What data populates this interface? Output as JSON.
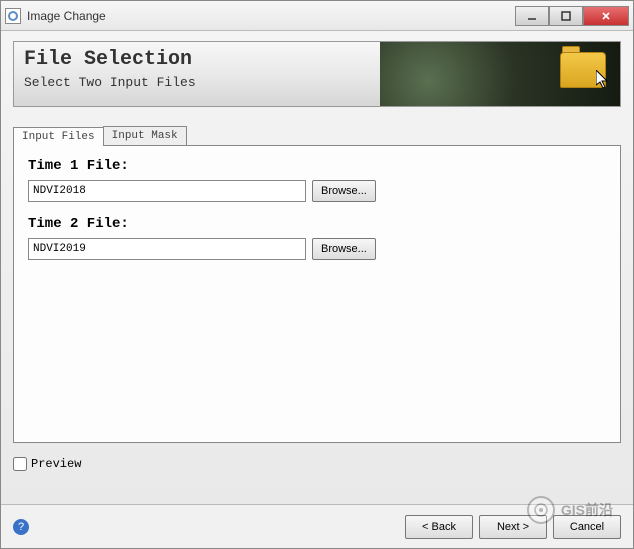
{
  "window": {
    "title": "Image Change"
  },
  "header": {
    "title": "File Selection",
    "subtitle": "Select Two Input Files"
  },
  "tabs": [
    {
      "label": "Input Files",
      "active": true
    },
    {
      "label": "Input Mask",
      "active": false
    }
  ],
  "fields": {
    "time1": {
      "label": "Time 1 File:",
      "value": "NDVI2018",
      "browse": "Browse..."
    },
    "time2": {
      "label": "Time 2 File:",
      "value": "NDVI2019",
      "browse": "Browse..."
    }
  },
  "preview": {
    "label": "Preview",
    "checked": false
  },
  "footer": {
    "help": "?",
    "back": "< Back",
    "next": "Next >",
    "cancel": "Cancel"
  },
  "watermark": {
    "text": "GIS前沿"
  }
}
